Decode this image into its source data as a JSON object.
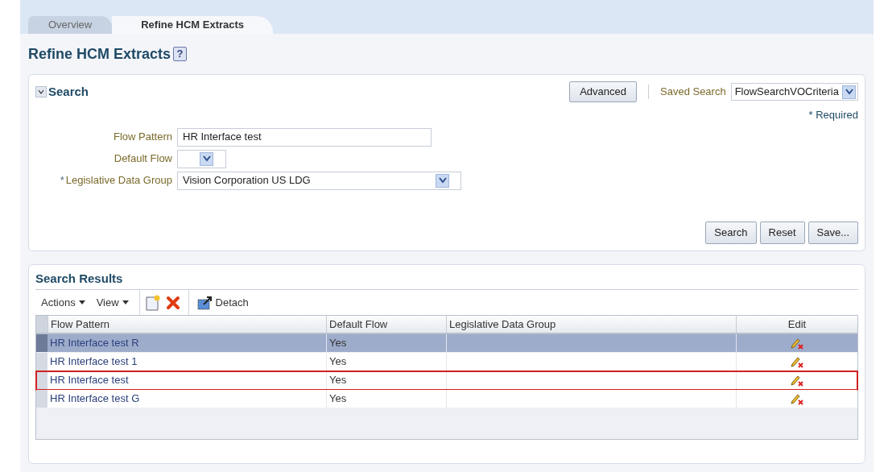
{
  "tabs": [
    {
      "label": "Overview",
      "selected": false
    },
    {
      "label": "Refine HCM Extracts",
      "selected": true
    }
  ],
  "page_title": "Refine HCM Extracts",
  "help_icon": "?",
  "search": {
    "title": "Search",
    "expanded": true,
    "advanced_button": "Advanced",
    "saved_search": {
      "label": "Saved Search",
      "value": "FlowSearchVOCriteria"
    },
    "required_note": "* Required",
    "fields": [
      {
        "label": "Flow Pattern",
        "kind": "text",
        "value": "HR Interface test"
      },
      {
        "label": "Default Flow",
        "kind": "select_small"
      },
      {
        "label": "Legislative Data Group",
        "required_mark": "*",
        "kind": "select",
        "value": "Vision Corporation US LDG"
      }
    ],
    "buttons": [
      "Search",
      "Reset",
      "Save..."
    ]
  },
  "results": {
    "title": "Search Results",
    "menus": [
      "Actions",
      "View"
    ],
    "detach": "Detach",
    "columns": [
      "Flow Pattern",
      "Default Flow",
      "Legislative Data Group",
      "Edit"
    ],
    "rows": [
      {
        "flow_pattern": "HR Interface test R",
        "default_flow": "Yes",
        "selected": true,
        "outlined": false
      },
      {
        "flow_pattern": "HR Interface test 1",
        "default_flow": "Yes",
        "selected": false,
        "outlined": false
      },
      {
        "flow_pattern": "HR Interface test",
        "default_flow": "Yes",
        "selected": false,
        "outlined": true
      },
      {
        "flow_pattern": "HR Interface test G",
        "default_flow": "Yes",
        "selected": false,
        "outlined": false
      }
    ]
  }
}
